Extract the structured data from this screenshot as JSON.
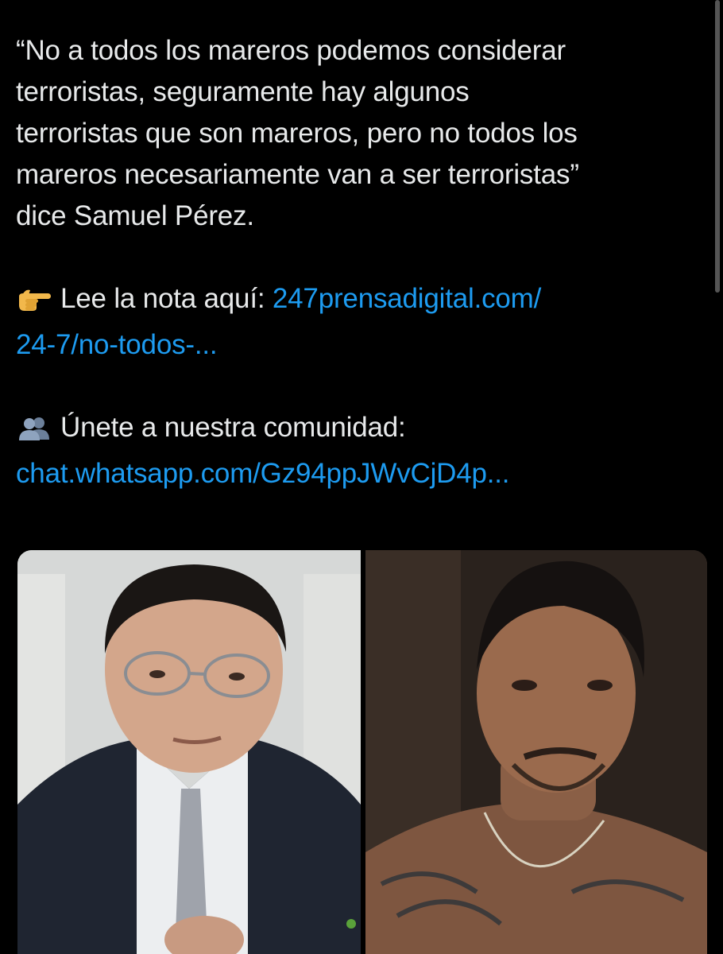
{
  "tweet": {
    "quote_lines": [
      "“No a todos los mareros podemos considerar",
      "terroristas, seguramente hay algunos",
      "terroristas que son mareros, pero no todos los",
      "mareros necesariamente van a ser terroristas”",
      "dice Samuel Pérez."
    ],
    "read_note": {
      "icon": "pointing-hand-icon",
      "label": "Lee la nota aquí: ",
      "link_line1": "247prensadigital.com/",
      "link_line2": "24-7/no-todos-..."
    },
    "community": {
      "icon": "people-silhouette-icon",
      "label": "Únete a nuestra comunidad:",
      "link": "chat.whatsapp.com/Gz94ppJWvCjD4p..."
    }
  },
  "media": {
    "photos": [
      {
        "subject": "man-in-suit-with-glasses-photo"
      },
      {
        "subject": "tattooed-young-man-photo"
      }
    ]
  },
  "colors": {
    "background": "#000000",
    "text": "#e7e9ea",
    "link": "#1d9bf0"
  }
}
